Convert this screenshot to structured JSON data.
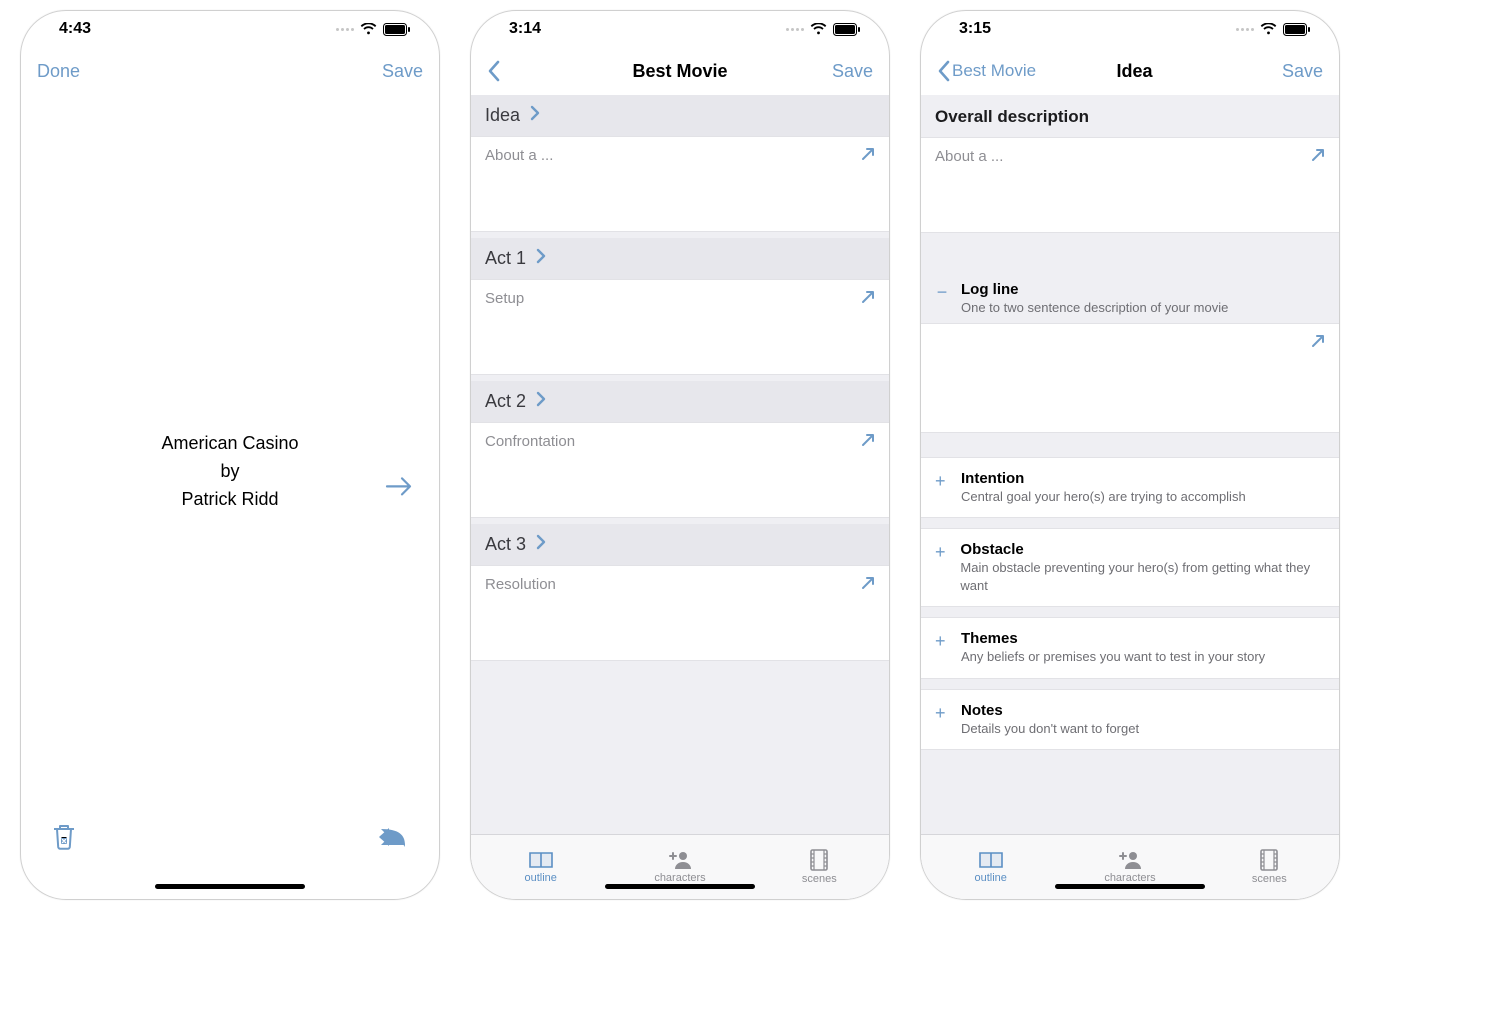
{
  "colors": {
    "tint": "#6e9bc8"
  },
  "screen1": {
    "status_time": "4:43",
    "nav_left": "Done",
    "nav_right": "Save",
    "title_line1": "American Casino",
    "title_line2": "by",
    "title_line3": "Patrick Ridd"
  },
  "screen2": {
    "status_time": "3:14",
    "nav_title": "Best Movie",
    "nav_right": "Save",
    "sections": [
      {
        "header": "Idea",
        "placeholder": "About a ..."
      },
      {
        "header": "Act 1",
        "placeholder": "Setup"
      },
      {
        "header": "Act 2",
        "placeholder": "Confrontation"
      },
      {
        "header": "Act 3",
        "placeholder": "Resolution"
      }
    ],
    "tabs": [
      {
        "label": "outline",
        "active": true
      },
      {
        "label": "characters",
        "active": false
      },
      {
        "label": "scenes",
        "active": false
      }
    ]
  },
  "screen3": {
    "status_time": "3:15",
    "nav_back": "Best Movie",
    "nav_title": "Idea",
    "nav_right": "Save",
    "overall_title": "Overall description",
    "overall_placeholder": "About a ...",
    "logline": {
      "title": "Log line",
      "desc": "One to two sentence description of your movie"
    },
    "rows": [
      {
        "title": "Intention",
        "desc": "Central goal your hero(s) are trying to accomplish"
      },
      {
        "title": "Obstacle",
        "desc": "Main obstacle preventing your hero(s) from getting what they want"
      },
      {
        "title": "Themes",
        "desc": "Any beliefs or premises you want to test in your story"
      },
      {
        "title": "Notes",
        "desc": "Details you don't want to forget"
      }
    ],
    "tabs": [
      {
        "label": "outline",
        "active": true
      },
      {
        "label": "characters",
        "active": false
      },
      {
        "label": "scenes",
        "active": false
      }
    ]
  }
}
